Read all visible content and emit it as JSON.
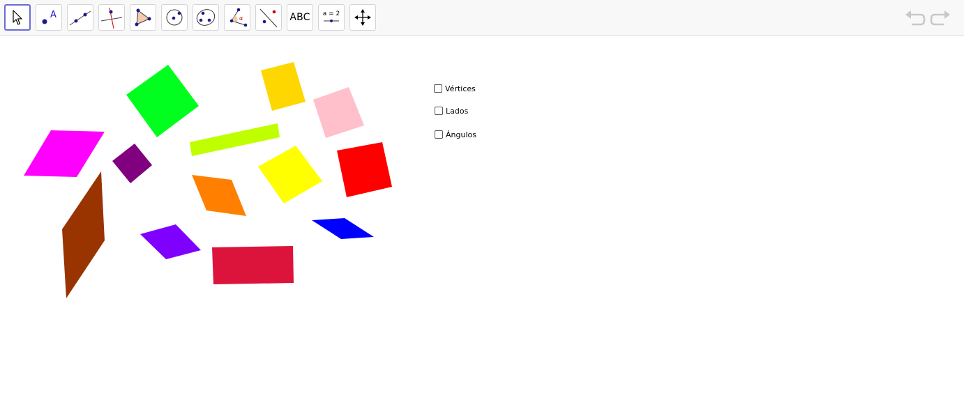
{
  "toolbar": {
    "tools": [
      {
        "name": "move-tool",
        "icon": "arrow-pointer-icon",
        "selected": true
      },
      {
        "name": "point-tool",
        "icon": "point-icon"
      },
      {
        "name": "line-tool",
        "icon": "line-icon"
      },
      {
        "name": "perpendicular-line-tool",
        "icon": "perpendicular-line-icon"
      },
      {
        "name": "polygon-tool",
        "icon": "polygon-icon"
      },
      {
        "name": "circle-tool",
        "icon": "circle-center-point-icon"
      },
      {
        "name": "conic-tool",
        "icon": "ellipse-icon"
      },
      {
        "name": "angle-tool",
        "icon": "angle-icon"
      },
      {
        "name": "reflect-tool",
        "icon": "reflect-icon"
      },
      {
        "name": "text-tool",
        "icon": "text-icon",
        "label": "ABC"
      },
      {
        "name": "slider-tool",
        "icon": "slider-icon",
        "label": "a = 2"
      },
      {
        "name": "move-graphics-view-tool",
        "icon": "move-view-icon"
      }
    ],
    "undo_icon": "undo-icon",
    "redo_icon": "redo-icon",
    "accent": "#6b6bd8"
  },
  "checkboxes": [
    {
      "label": "Vértices",
      "checked": false
    },
    {
      "label": "Lados",
      "checked": false
    },
    {
      "label": "Ángulos",
      "checked": false
    }
  ],
  "shapes": [
    {
      "name": "green-square",
      "color": "#00ff1e"
    },
    {
      "name": "gold-square",
      "color": "#ffd700"
    },
    {
      "name": "pink-square",
      "color": "#ffc0cb"
    },
    {
      "name": "magenta-parallelogram",
      "color": "#ff00ff"
    },
    {
      "name": "purple-square",
      "color": "#800080"
    },
    {
      "name": "lime-rectangle",
      "color": "#bfff00"
    },
    {
      "name": "yellow-square",
      "color": "#ffff00"
    },
    {
      "name": "red-square",
      "color": "#ff0000"
    },
    {
      "name": "orange-parallelogram",
      "color": "#ff8000"
    },
    {
      "name": "brown-parallelogram",
      "color": "#993300"
    },
    {
      "name": "violet-rhombus",
      "color": "#8000ff"
    },
    {
      "name": "blue-parallelogram",
      "color": "#0000ff"
    },
    {
      "name": "crimson-rectangle",
      "color": "#dc143c"
    }
  ]
}
